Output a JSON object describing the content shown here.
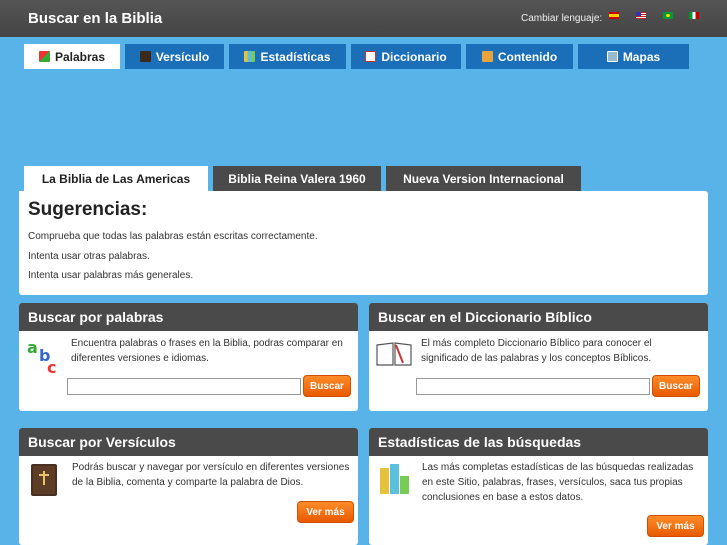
{
  "header": {
    "title": "Buscar en la Biblia",
    "language_label": "Cambiar lenguaje:",
    "flags": [
      "flag-es-icon",
      "flag-us-icon",
      "flag-br-icon",
      "flag-it-icon"
    ]
  },
  "nav": {
    "tabs": [
      {
        "label": "Palabras",
        "icon": "abc-icon",
        "active": true
      },
      {
        "label": "Versículo",
        "icon": "book-icon",
        "active": false
      },
      {
        "label": "Estadísticas",
        "icon": "bar-chart-icon",
        "active": false
      },
      {
        "label": "Diccionario",
        "icon": "open-book-icon",
        "active": false
      },
      {
        "label": "Contenido",
        "icon": "box-icon",
        "active": false
      },
      {
        "label": "Mapas",
        "icon": "map-icon",
        "active": false
      }
    ]
  },
  "versions": {
    "tabs": [
      {
        "label": "La Biblia de Las Americas",
        "active": true
      },
      {
        "label": "Biblia Reina Valera 1960",
        "active": false
      },
      {
        "label": "Nueva Version Internacional",
        "active": false
      }
    ]
  },
  "suggestions": {
    "title": "Sugerencias:",
    "items": [
      "Comprueba que todas las palabras están escritas correctamente.",
      "Intenta usar otras palabras.",
      "Intenta usar palabras más generales."
    ]
  },
  "boxes": {
    "words": {
      "title": "Buscar por palabras",
      "desc": "Encuentra palabras o frases en la Biblia, podras comparar en diferentes versiones e idiomas.",
      "input_value": "",
      "button": "Buscar"
    },
    "dictionary": {
      "title": "Buscar en el Diccionario Bíblico",
      "desc": "El más completo Diccionario Bíblico para conocer el significado de las palabras y los conceptos Bíblicos.",
      "input_value": "",
      "button": "Buscar"
    },
    "verses": {
      "title": "Buscar por Versículos",
      "desc": "Podrás buscar y navegar por versículo en diferentes versiones de la Biblia, comenta y comparte la palabra de Dios.",
      "button": "Ver más"
    },
    "stats": {
      "title": "Estadísticas de las búsquedas",
      "desc": "Las más completas estadísticas de las búsquedas realizadas en este Sitio, palabras, frases, versículos, saca tus propias conclusiones en base a estos datos.",
      "button": "Ver más"
    }
  },
  "colors": {
    "background": "#58b4e8",
    "nav_tab": "#1a6fb8",
    "header": "#4a4a4a",
    "button": "#f26f0f"
  }
}
